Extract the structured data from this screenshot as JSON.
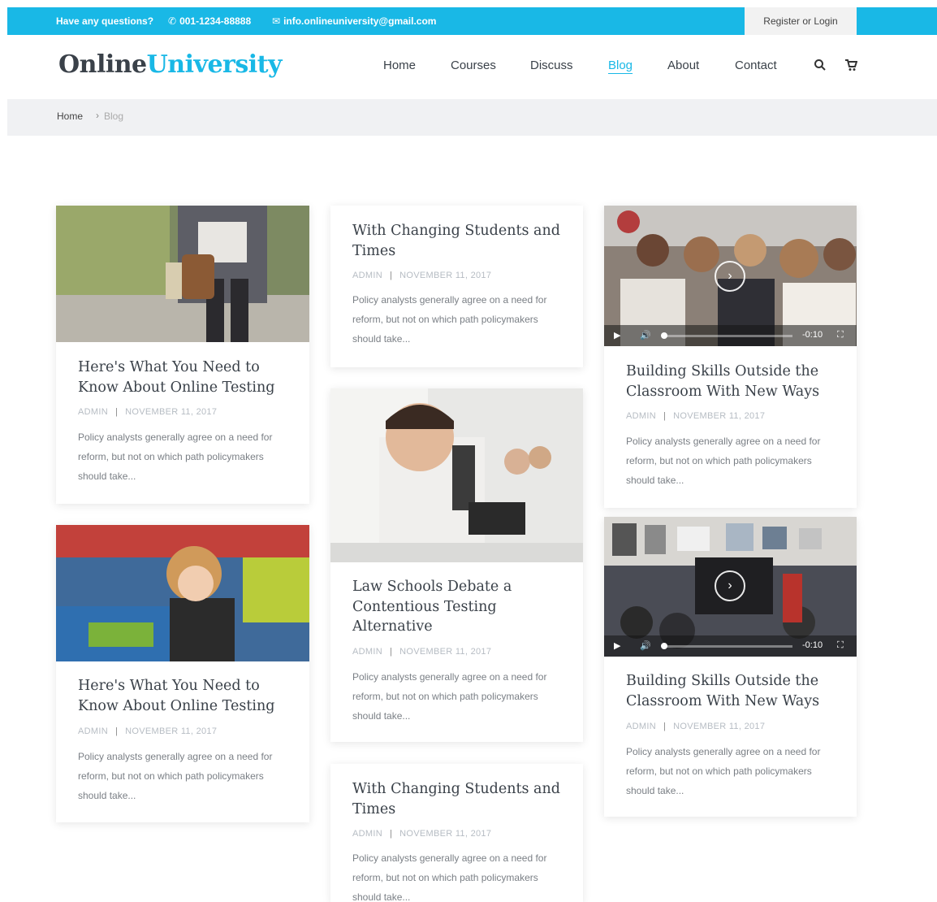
{
  "topbar": {
    "questions": "Have any questions?",
    "phone": "001-1234-88888",
    "email": "info.onlineuniversity@gmail.com",
    "register": "Register or Login"
  },
  "logo": {
    "part1": "Online",
    "part2": "University"
  },
  "nav": [
    "Home",
    "Courses",
    "Discuss",
    "Blog",
    "About",
    "Contact"
  ],
  "nav_active": "Blog",
  "breadcrumb": {
    "home": "Home",
    "separator": "›",
    "current": "Blog"
  },
  "colors": {
    "accent": "#19b8e6",
    "heading": "#3a4149"
  },
  "icons": {
    "search": "search-icon",
    "cart": "cart-icon",
    "phone": "phone-icon",
    "email": "email-icon"
  },
  "posts": [
    {
      "title": "Here's What You Need to Know About Online Testing",
      "author": "ADMIN",
      "date": "NOVEMBER 11, 2017",
      "excerpt": "Policy analysts generally agree on a need for reform, but not on which path policymakers should take..."
    },
    {
      "title": "Here's What You Need to Know About Online Testing",
      "author": "ADMIN",
      "date": "NOVEMBER 11, 2017",
      "excerpt": "Policy analysts generally agree on a need for reform, but not on which path policymakers should take..."
    },
    {
      "title": "With Changing Students and Times",
      "author": "ADMIN",
      "date": "NOVEMBER 11, 2017",
      "excerpt": "Policy analysts generally agree on a need for reform, but not on which path policymakers should take..."
    },
    {
      "title": "Law Schools Debate a Contentious Testing Alternative",
      "author": "ADMIN",
      "date": "NOVEMBER 11, 2017",
      "excerpt": "Policy analysts generally agree on a need for reform, but not on which path policymakers should take..."
    },
    {
      "title": "With Changing Students and Times",
      "author": "ADMIN",
      "date": "NOVEMBER 11, 2017",
      "excerpt": "Policy analysts generally agree on a need for reform, but not on which path policymakers should take..."
    },
    {
      "title": "Building Skills Outside the Classroom With New Ways",
      "author": "ADMIN",
      "date": "NOVEMBER 11, 2017",
      "excerpt": "Policy analysts generally agree on a need for reform, but not on which path policymakers should take..."
    },
    {
      "title": "Building Skills Outside the Classroom With New Ways",
      "author": "ADMIN",
      "date": "NOVEMBER 11, 2017",
      "excerpt": "Policy analysts generally agree on a need for reform, but not on which path policymakers should take..."
    }
  ],
  "video": {
    "time": "-0:10"
  }
}
